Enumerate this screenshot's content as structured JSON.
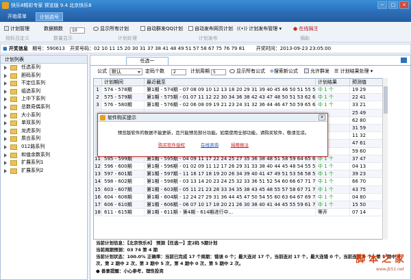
{
  "window": {
    "title": "快乐8精彩专家 预览版 9.4 北京快乐8",
    "controls": [
      "−",
      "□",
      "×"
    ]
  },
  "main_tabs": [
    {
      "label": "开始菜单"
    },
    {
      "label": "计划选号"
    }
  ],
  "toolbar": {
    "plan_manage": "计划管理",
    "data_periods_label": "数据期数",
    "data_periods_value": "10",
    "show_all_plans": "显示所有计划",
    "auto_qq": "自动群发QQ计划",
    "auto_web": "自动发布网页计划",
    "plan_publish_manage": "计划发布管理",
    "online_donate": "在线捐注",
    "sub_labels": [
      "指标且定义",
      "数量显示",
      "计划处理",
      "计划发布",
      "捐助"
    ]
  },
  "infobar": {
    "label": "开奖信息",
    "period": "期号：590613",
    "numbers": "开奖号码：02 10 11 15 20 30 31 37 38 41 48 49 51 57 58 67 75 76 79 81",
    "time": "开奖时间：2013-09-23 23:05:00"
  },
  "left_panel": {
    "header": "计划列表",
    "items": [
      "任选系列",
      "胆码系列",
      "不定位系列",
      "组选系列",
      "上中下系列",
      "总数奇偶系列",
      "大小系列",
      "单双系列",
      "龙虎系列",
      "质合系列",
      "012路系列",
      "和值余数系列",
      "扩展系列1",
      "扩展系列2"
    ]
  },
  "panel_tab": "任选一",
  "controls": {
    "formula_label": "公式",
    "formula_value": "默认",
    "fixed_label": "定码个数",
    "fixed_value": "2",
    "period_label": "计划周期",
    "period_value": "5",
    "show_all_formula": "显示所有公式",
    "search_formula": "搜索新公式",
    "allow_group": "允许群发",
    "result_process": "计划结果处理"
  },
  "grid": {
    "headers": [
      "",
      "计划期间",
      "最近截至",
      "计划结果",
      "预测值"
    ],
    "rows": [
      {
        "n": "1",
        "period": "574 - 578期",
        "latest": "第1期 - 574期 - 07 08 09 10 12 13 18 20 29 31 39 40 45 46 50 51 55 57 69 73",
        "result": "中 1 个",
        "value": "19 29"
      },
      {
        "n": "2",
        "period": "575 - 579期",
        "latest": "第1期 - 575期 - 01 07 11 12 22 30 34 36 38 42 43 47 48 50 51 53 62 66 68 72 75",
        "result": "中 1 个",
        "value": "22 41"
      },
      {
        "n": "3",
        "period": "576 - 580期",
        "latest": "第1期 - 576期 - 02 06 08 09 19 21 23 24 31 32 36 44 46 47 50 59 65 67 72 80",
        "result": "中 1 个",
        "value": "33 21"
      },
      {
        "n": "",
        "period": "",
        "latest": "",
        "result": "",
        "value": "25 49"
      },
      {
        "n": "",
        "period": "",
        "latest": "",
        "result": "",
        "value": "62 80"
      },
      {
        "n": "",
        "period": "",
        "latest": "",
        "result": "",
        "value": "31 59"
      },
      {
        "n": "",
        "period": "",
        "latest": "",
        "result": "",
        "value": "11 32"
      },
      {
        "n": "",
        "period": "",
        "latest": "",
        "result": "",
        "value": "47 61"
      },
      {
        "n": "",
        "period": "",
        "latest": "",
        "result": "",
        "value": "59 60"
      },
      {
        "n": "11",
        "period": "595 - 599期",
        "latest": "第1期 - 595期 - 04 09 11 17 22 24 25 27 35 36 38 48 51 58 59 64 65 66 67 78",
        "result": "中 1 个",
        "value": "37 47"
      },
      {
        "n": "12",
        "period": "596 - 600期",
        "latest": "第1期 - 596期 - 01 02 09 11 12 17 26 29 31 33 38 40 44 45 48 54 55 58 70",
        "result": "中 1 个",
        "value": "04 13"
      },
      {
        "n": "13",
        "period": "597 - 601期",
        "latest": "第1期 - 597期 - 11 16 17 18 19 20 26 34 39 40 41 47 49 51 53 56 58 59 66 74",
        "result": "中 1 个",
        "value": "39 23"
      },
      {
        "n": "14",
        "period": "598 - 602期",
        "latest": "第1期 - 598期 - 03 13 14 20 23 24 25 32 33 36 51 52 54 60 66 67 71 76 77",
        "result": "中 1 个",
        "value": "66 70"
      },
      {
        "n": "15",
        "period": "603 - 607期",
        "latest": "第1期 - 603期 - 05 11 21 23 28 33 34 35 38 43 45 48 55 57 58 67 71 75 76 77",
        "result": "中 1 个",
        "value": "43 75"
      },
      {
        "n": "16",
        "period": "604 - 608期",
        "latest": "第1期 - 604期 - 12 24 27 29 31 36 44 45 47 50 54 55 60 63 64 67 69 71 74 77",
        "result": "中 1 个",
        "value": "04 80"
      },
      {
        "n": "17",
        "period": "606 - 610期",
        "latest": "第1期 - 606期 - 06 07 10 17 18 20 21 26 30 38 40 41 44 45 55 59 61 75 79",
        "result": "中 1 个",
        "value": "15 50"
      },
      {
        "n": "18",
        "period": "611 - 615期",
        "latest": "第1期 - 611期 - 第4期 - 614期进行中...",
        "result": "等开",
        "value": "07 14"
      }
    ]
  },
  "bottom": {
    "line1": "当前计划信息：【北京快乐8】 预测【任选一】定2码 5期计划",
    "line2": "当前周期预测：03 74  第 4 期",
    "line3": "当前计划状态：100.0% 正确率：当前已完成 17 个周期：错误 0 个；最大连对 17 个，当前连对 17 个，最大连错 0 个，当前连错 0 个；第 1 期中 8 次，第 2 期中 2 次，第 3 期中 5 次，第 4 期中 0 次，第 5 期中 2 次。",
    "line4": "● 善意提醒：小心参考，理性投资"
  },
  "popup": {
    "title": "软件购买提示",
    "message": "预览版软件的数据不能更新，且只能预览部分功能。如需使用全部功能，请购买软件，敬请见谅。",
    "links": [
      "购买软件授权",
      "在线咨询",
      "捐赠报注"
    ]
  },
  "watermark": {
    "text": "脚 本 之 家",
    "url": "www.jb51.net"
  },
  "colors": {
    "title": "#2a72be",
    "green": "#149a2a",
    "red": "#d0202a"
  }
}
